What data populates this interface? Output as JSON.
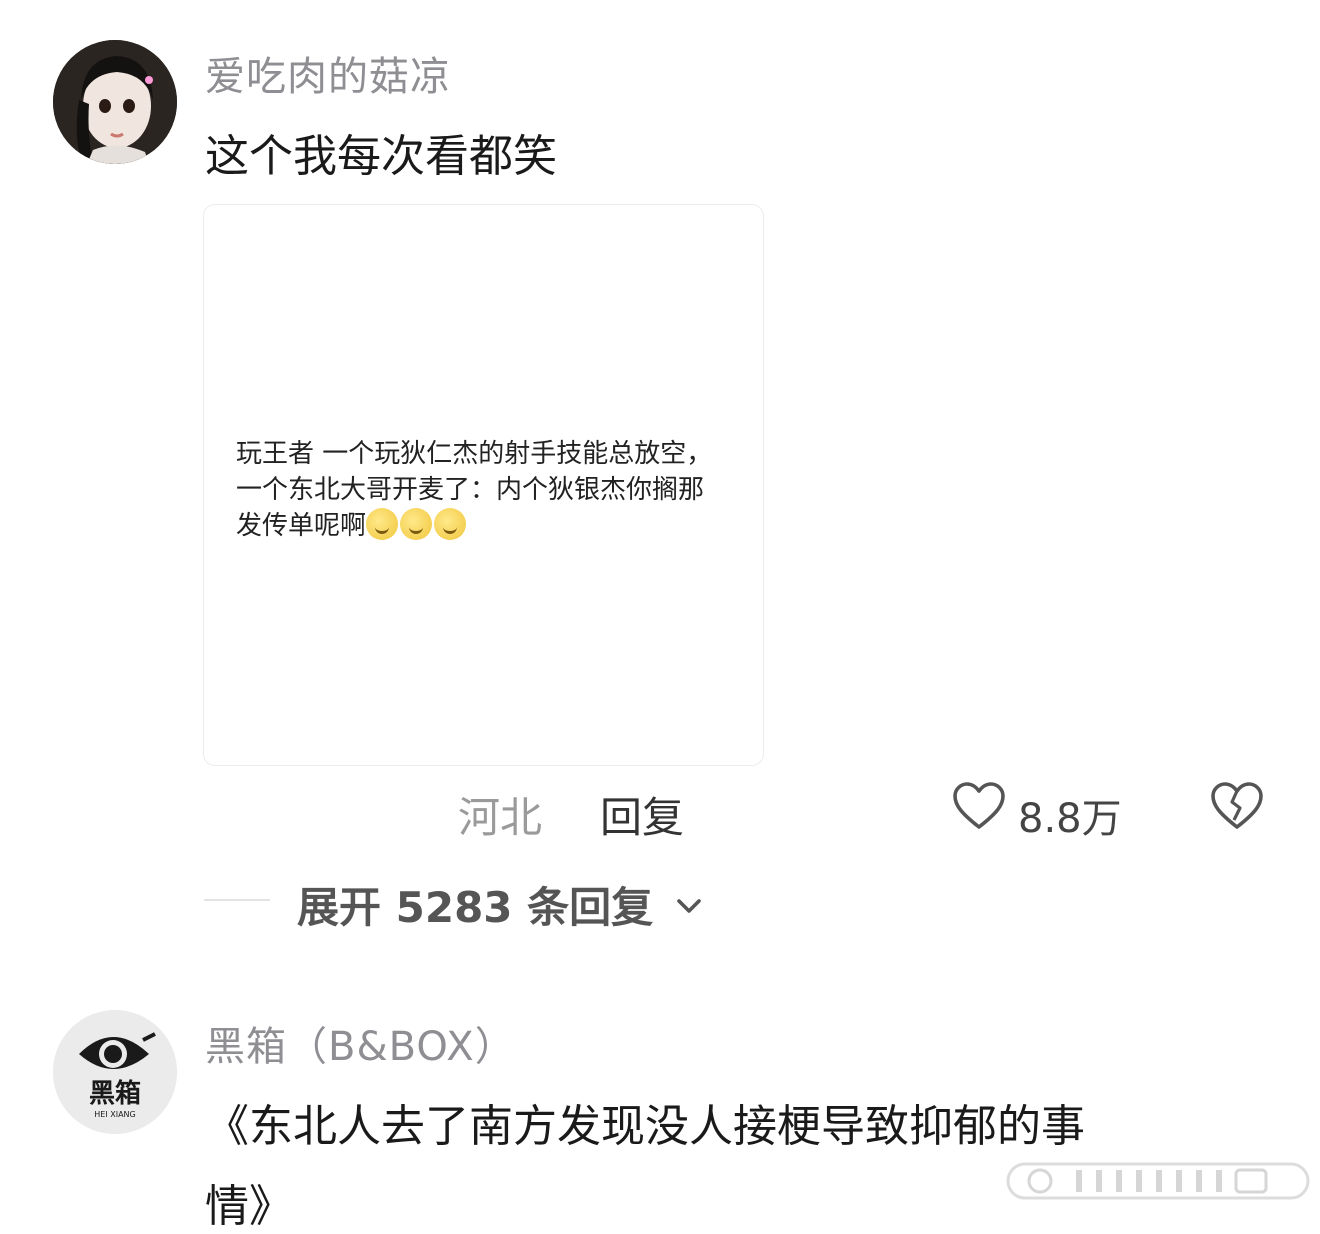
{
  "comments": [
    {
      "username": "爱吃肉的菇凉",
      "text": "这个我每次看都笑",
      "card": {
        "lines": [
          "玩王者 一个玩狄仁杰的射手技能总放空，",
          "一个东北大哥开麦了：内个狄银杰你搁那",
          "发传单呢啊"
        ],
        "emoji_count": 3
      },
      "location": "河北",
      "reply_label": "回复",
      "like_count": "8.8万",
      "expand_label": "展开 5283 条回复"
    },
    {
      "username": "黑箱（B&BOX）",
      "text_line1": "《东北人去了南方发现没人接梗导致抑郁的事",
      "text_line2": "情》",
      "avatar_logo_text": "黑箱",
      "avatar_logo_subtext": "HEI XIANG"
    }
  ],
  "colors": {
    "meta_gray": "#9a9a9a",
    "text_dark": "#1a1a1a"
  }
}
